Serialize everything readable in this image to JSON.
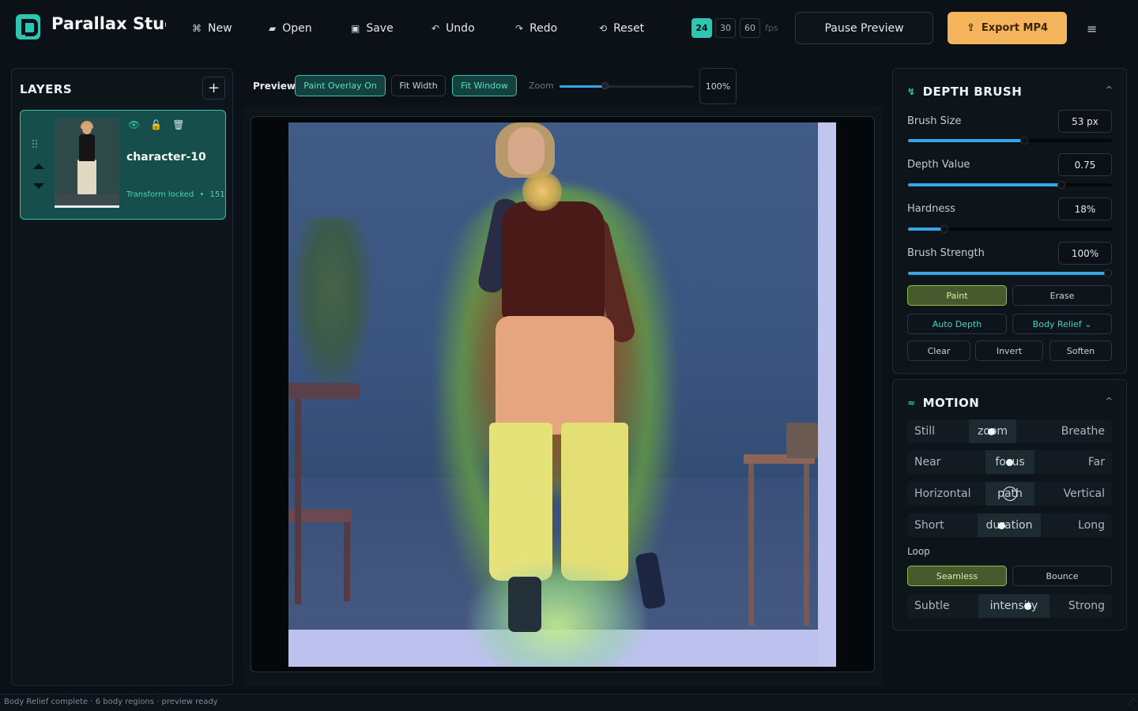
{
  "app": {
    "title": "Parallax Studio",
    "logo_icon": "parallax-p-logo"
  },
  "toolbar": {
    "new_label": "New",
    "open_label": "Open",
    "save_label": "Save",
    "undo_label": "Undo",
    "redo_label": "Redo",
    "reset_label": "Reset",
    "icons": {
      "new": "⌘",
      "open": "▰",
      "save": "▣",
      "undo": "↶",
      "redo": "↷",
      "reset": "⟲",
      "export": "⇪",
      "menu": "≡"
    },
    "fps_options": [
      "24",
      "30",
      "60"
    ],
    "fps_selected": "24",
    "fps_unit": "fps",
    "pause_label": "Pause Preview",
    "export_label": "Export MP4"
  },
  "layers": {
    "title": "LAYERS",
    "add_label": "+",
    "items": [
      {
        "name": "character-10",
        "status": "Transform locked",
        "separator": "•",
        "count": "151"
      }
    ]
  },
  "view": {
    "preview_label": "Preview",
    "paint_overlay_label": "Paint Overlay  On",
    "fit_width_label": "Fit Width",
    "fit_window_label": "Fit Window",
    "zoom_label": "Zoom",
    "zoom_value": "100%",
    "zoom_fraction": 0.34
  },
  "depth_brush": {
    "title": "DEPTH BRUSH",
    "collapse_icon": "^",
    "params": [
      {
        "label": "Brush Size",
        "value": "53 px",
        "fraction": 0.57
      },
      {
        "label": "Depth Value",
        "value": "0.75",
        "fraction": 0.75
      },
      {
        "label": "Hardness",
        "value": "18%",
        "fraction": 0.18
      },
      {
        "label": "Brush Strength",
        "value": "100%",
        "fraction": 1.0
      }
    ],
    "mode_paint": "Paint",
    "mode_erase": "Erase",
    "auto_depth_label": "Auto Depth",
    "body_relief_label": "Body Relief ⌄",
    "clear_label": "Clear",
    "invert_label": "Invert",
    "soften_label": "Soften"
  },
  "motion": {
    "title": "MOTION",
    "title_icon": "≈",
    "collapse_icon": "^",
    "rows": [
      {
        "left": "Still",
        "mid": "zoom",
        "right": "Breathe",
        "value": 0.41
      },
      {
        "left": "Near",
        "mid": "focus",
        "right": "Far",
        "value": 0.5
      },
      {
        "left": "Horizontal",
        "mid": "path",
        "right": "Vertical",
        "value": 0.5
      },
      {
        "left": "Short",
        "mid": "duration",
        "right": "Long",
        "value": 0.46
      }
    ],
    "loop_label": "Loop",
    "loop_seamless": "Seamless",
    "loop_bounce": "Bounce",
    "intensity": {
      "left": "Subtle",
      "mid": "intensity",
      "right": "Strong",
      "value": 0.59
    }
  },
  "status_bar": {
    "text": "Body Relief complete · 6 body regions · preview ready"
  },
  "colors": {
    "accent": "#2ec6b1",
    "export": "#f4b45b",
    "slider": "#37a6e6",
    "active_mode": "#8bbf4e"
  }
}
